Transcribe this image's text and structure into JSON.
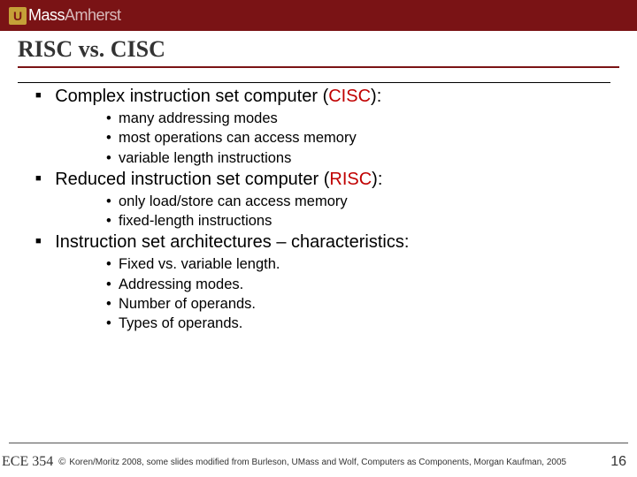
{
  "logo": {
    "u": "U",
    "mass": "Mass",
    "amherst": "Amherst"
  },
  "title": "RISC vs. CISC",
  "sections": [
    {
      "heading_pre": "Complex instruction set computer (",
      "heading_hl": "CISC",
      "heading_post": "):",
      "bullets": [
        "many addressing modes",
        "most operations can access memory",
        "variable length instructions"
      ]
    },
    {
      "heading_pre": "Reduced instruction set computer (",
      "heading_hl": "RISC",
      "heading_post": "):",
      "bullets": [
        "only load/store can access memory",
        "fixed-length instructions"
      ]
    },
    {
      "heading_pre": "Instruction set architectures – characteristics:",
      "heading_hl": "",
      "heading_post": "",
      "bullets": [
        "Fixed vs. variable length.",
        "Addressing modes.",
        "Number of operands.",
        "Types of operands."
      ]
    }
  ],
  "footer": {
    "course": "ECE 354",
    "copy": "©",
    "credits": "Koren/Moritz 2008,  some slides modified from Burleson, UMass and Wolf, Computers as Components, Morgan Kaufman, 2005",
    "page": "16"
  }
}
